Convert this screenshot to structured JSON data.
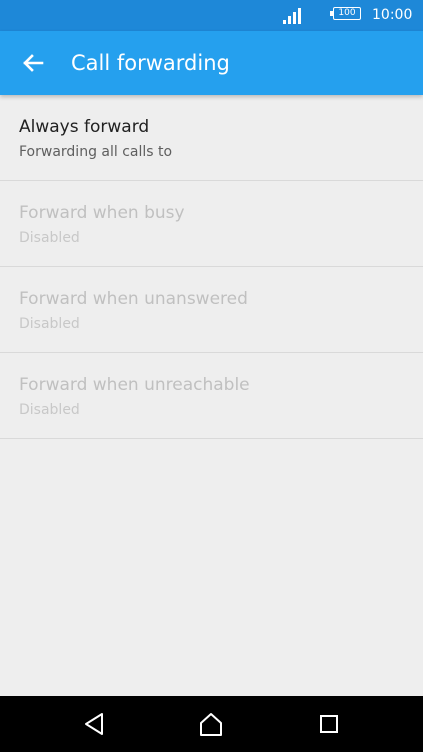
{
  "status_bar": {
    "battery_level": "100",
    "time": "10:00",
    "icons": [
      "signal-icon",
      "battery-icon"
    ]
  },
  "app_bar": {
    "title": "Call forwarding",
    "back_icon": "arrow-left-icon",
    "background_color": "#25a0ee"
  },
  "settings": [
    {
      "title": "Always forward",
      "summary": "Forwarding all calls to",
      "enabled": true
    },
    {
      "title": "Forward when busy",
      "summary": "Disabled",
      "enabled": false
    },
    {
      "title": "Forward when unanswered",
      "summary": "Disabled",
      "enabled": false
    },
    {
      "title": "Forward when unreachable",
      "summary": "Disabled",
      "enabled": false
    }
  ],
  "nav_bar": {
    "icons": [
      "back-triangle-icon",
      "home-icon",
      "recents-square-icon"
    ]
  }
}
